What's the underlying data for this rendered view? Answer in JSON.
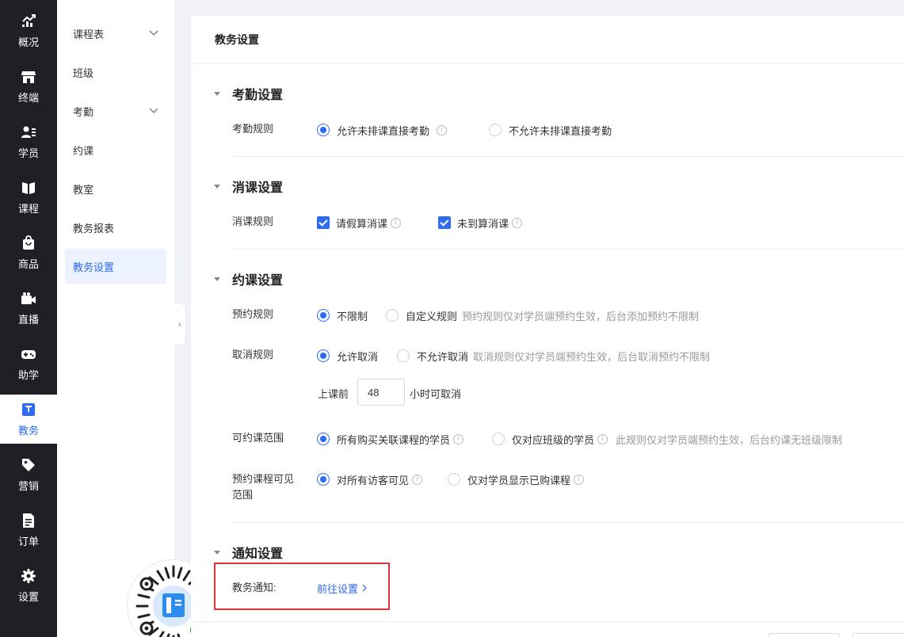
{
  "rail": {
    "items": [
      {
        "label": "概况",
        "icon": "trend-chart-icon"
      },
      {
        "label": "终端",
        "icon": "storefront-icon"
      },
      {
        "label": "学员",
        "icon": "users-icon"
      },
      {
        "label": "课程",
        "icon": "book-icon"
      },
      {
        "label": "商品",
        "icon": "shopping-bag-icon"
      },
      {
        "label": "直播",
        "icon": "video-camera-icon"
      },
      {
        "label": "助学",
        "icon": "gamepad-icon"
      },
      {
        "label": "教务",
        "icon": "calendar-board-icon"
      },
      {
        "label": "营销",
        "icon": "tag-icon"
      },
      {
        "label": "订单",
        "icon": "document-icon"
      },
      {
        "label": "设置",
        "icon": "gear-icon"
      }
    ],
    "active": "教务"
  },
  "submenu": {
    "items": [
      {
        "label": "课程表",
        "expandable": true
      },
      {
        "label": "班级",
        "expandable": false
      },
      {
        "label": "考勤",
        "expandable": true
      },
      {
        "label": "约课",
        "expandable": false
      },
      {
        "label": "教室",
        "expandable": false
      },
      {
        "label": "教务报表",
        "expandable": false
      },
      {
        "label": "教务设置",
        "expandable": false
      }
    ],
    "active": "教务设置"
  },
  "page": {
    "title": "教务设置",
    "attendance": {
      "title": "考勤设置",
      "rule_label": "考勤规则",
      "opt_allow": "允许未排课直接考勤",
      "opt_disallow": "不允许未排课直接考勤",
      "selected": "opt_allow"
    },
    "consume": {
      "title": "消课设置",
      "rule_label": "消课规则",
      "opt_leave": "请假算消课",
      "opt_absent": "未到算消课",
      "leave_checked": true,
      "absent_checked": true
    },
    "booking": {
      "title": "约课设置",
      "reserve_label": "预约规则",
      "reserve_unlimited": "不限制",
      "reserve_custom": "自定义规则",
      "reserve_hint": "预约规则仅对学员端预约生效，后台添加预约不限制",
      "cancel_label": "取消规则",
      "cancel_allow": "允许取消",
      "cancel_disallow": "不允许取消",
      "cancel_hint": "取消规则仅对学员端预约生效，后台取消预约不限制",
      "before_prefix": "上课前",
      "before_hours": "48",
      "before_suffix": "小时可取消",
      "scope_label": "可约课范围",
      "scope_all": "所有购买关联课程的学员",
      "scope_class": "仅对应班级的学员",
      "scope_hint": "此规则仅对学员端预约生效，后台约课无班级限制",
      "visible_label_1": "预约课程可见",
      "visible_label_2": "范围",
      "visible_all": "对所有访客可见",
      "visible_bought": "仅对学员显示已购课程"
    },
    "notify": {
      "title": "通知设置",
      "label": "教务通知:",
      "link": "前往设置"
    }
  },
  "colors": {
    "rail_bg": "#1f2026",
    "accent": "#2d6cf0",
    "highlight": "#d9363e"
  }
}
